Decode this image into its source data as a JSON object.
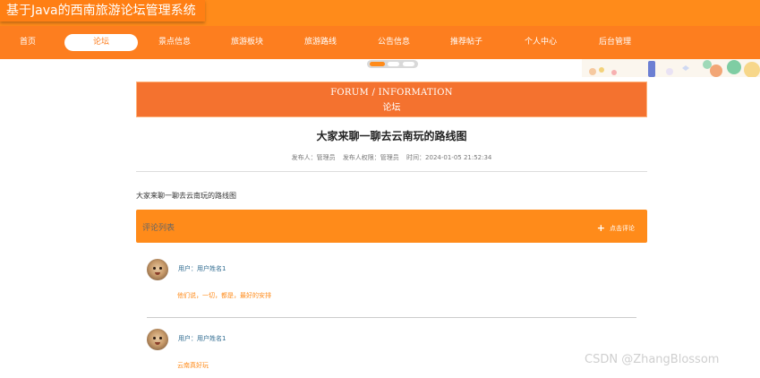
{
  "header": {
    "site_title": "基于Java的西南旅游论坛管理系统"
  },
  "nav": {
    "items": [
      {
        "label": "首页"
      },
      {
        "label": "论坛"
      },
      {
        "label": "景点信息"
      },
      {
        "label": "旅游板块"
      },
      {
        "label": "旅游路线"
      },
      {
        "label": "公告信息"
      },
      {
        "label": "推荐帖子"
      },
      {
        "label": "个人中心"
      },
      {
        "label": "后台管理"
      }
    ],
    "active_index": 1
  },
  "section": {
    "title_en": "FORUM / INFORMATION",
    "title_cn": "论坛"
  },
  "post": {
    "title": "大家来聊一聊去云南玩的路线图",
    "author_label": "发布人：管理员",
    "permission_label": "发布人权限：管理员",
    "time_label": "时间：2024-01-05 21:52:34",
    "content": "大家来聊一聊去云南玩的路线图"
  },
  "comments": {
    "title": "评论列表",
    "add_label": "点击评论",
    "items": [
      {
        "user": "用户：用户姓名1",
        "text": "他们说，一切，都是，最好的安排"
      },
      {
        "user": "用户：用户姓名1",
        "text": "云南真好玩"
      }
    ]
  },
  "watermark": "CSDN @ZhangBlossom",
  "colors": {
    "primary": "#ff8b1a",
    "nav": "#fd7e1f",
    "header_panel": "#f4722f",
    "link": "#2d6a8f"
  },
  "icons": [
    "plus-icon",
    "avatar-image"
  ]
}
